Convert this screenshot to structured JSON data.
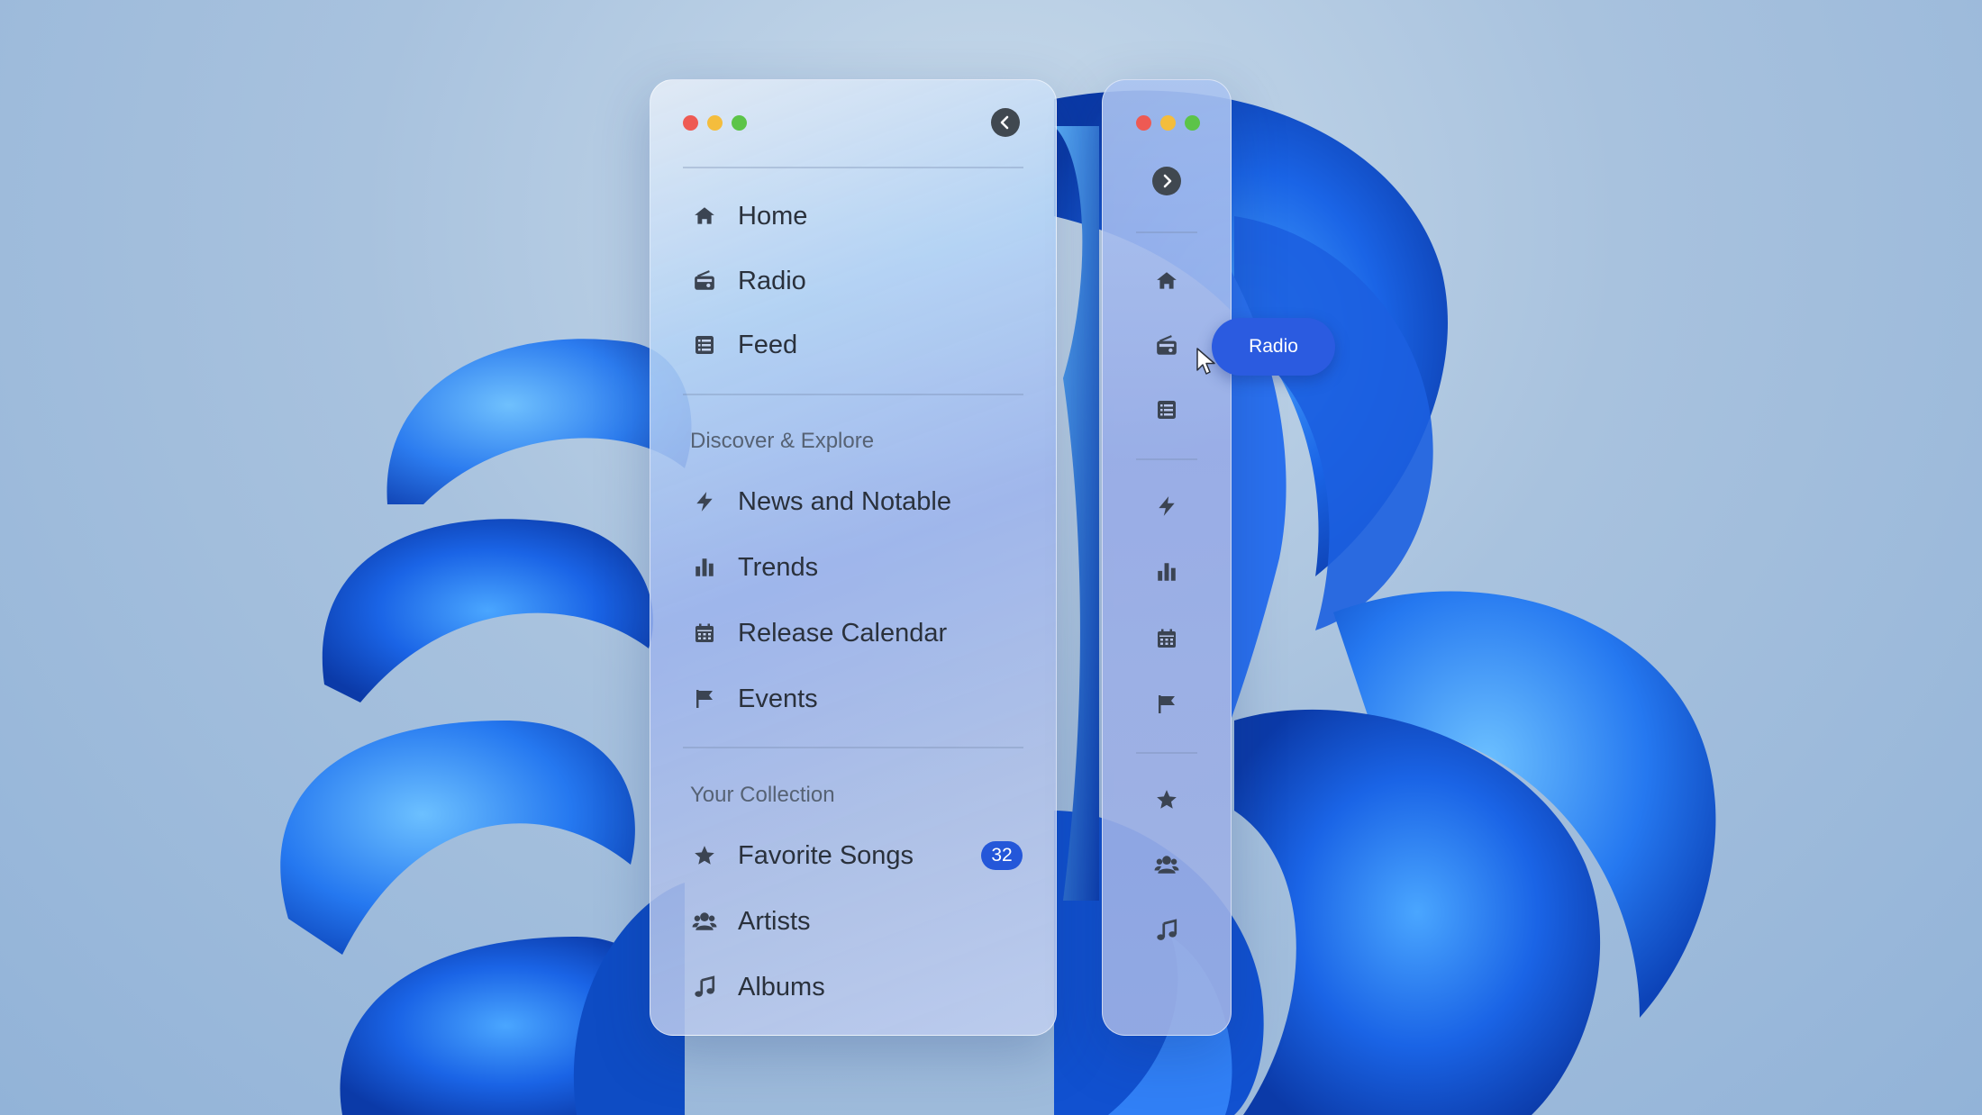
{
  "expanded_sidebar": {
    "toggle_icon": "chevron-left-icon",
    "primary_items": [
      {
        "label": "Home",
        "icon": "home-icon"
      },
      {
        "label": "Radio",
        "icon": "radio-icon"
      },
      {
        "label": "Feed",
        "icon": "list-icon"
      }
    ],
    "discover_section": {
      "title": "Discover & Explore",
      "items": [
        {
          "label": "News and Notable",
          "icon": "bolt-icon"
        },
        {
          "label": "Trends",
          "icon": "bar-chart-icon"
        },
        {
          "label": "Release Calendar",
          "icon": "calendar-icon"
        },
        {
          "label": "Events",
          "icon": "flag-icon"
        }
      ]
    },
    "collection_section": {
      "title": "Your Collection",
      "items": [
        {
          "label": "Favorite Songs",
          "icon": "star-icon",
          "badge": "32"
        },
        {
          "label": "Artists",
          "icon": "users-icon"
        },
        {
          "label": "Albums",
          "icon": "music-note-icon"
        }
      ]
    }
  },
  "collapsed_sidebar": {
    "toggle_icon": "chevron-right-icon",
    "icons": [
      "home-icon",
      "radio-icon",
      "list-icon",
      "bolt-icon",
      "bar-chart-icon",
      "calendar-icon",
      "flag-icon",
      "star-icon",
      "users-icon",
      "music-note-icon"
    ],
    "tooltip": "Radio"
  },
  "colors": {
    "accent": "#2b5be0",
    "traffic_red": "#ee5a53",
    "traffic_yellow": "#f4bd3d",
    "traffic_green": "#5cc448"
  }
}
